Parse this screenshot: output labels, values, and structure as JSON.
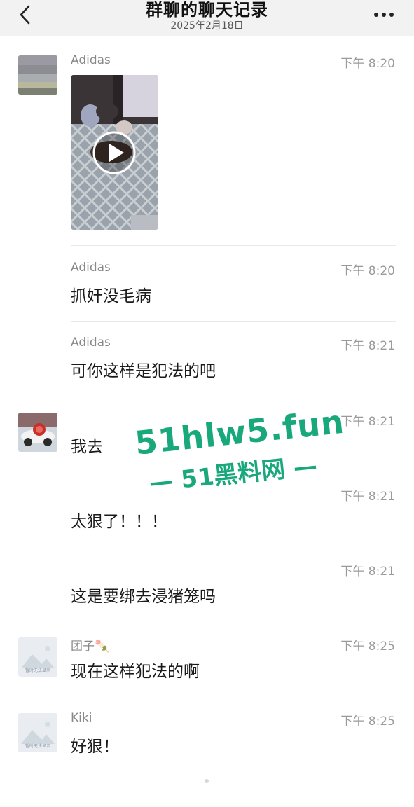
{
  "header": {
    "title": "群聊的聊天记录",
    "date": "2025年2月18日"
  },
  "messages": [
    {
      "name": "Adidas",
      "time": "下午 8:20",
      "type": "video"
    },
    {
      "name": "Adidas",
      "time": "下午 8:20",
      "text": "抓奸没毛病"
    },
    {
      "name": "Adidas",
      "time": "下午 8:21",
      "text": "可你这样是犯法的吧"
    },
    {
      "name": "",
      "time": "下午 8:21",
      "text": "我去"
    },
    {
      "name": "",
      "time": "下午 8:21",
      "text": "太狠了！！！"
    },
    {
      "name": "",
      "time": "下午 8:21",
      "text": "这是要绑去浸猪笼吗"
    },
    {
      "name": "团子🍡",
      "time": "下午 8:25",
      "text": "现在这样犯法的啊"
    },
    {
      "name": "Kiki",
      "time": "下午 8:25",
      "text": "好狠！"
    }
  ],
  "avatars": {
    "placeholder_caption": "暂时无法显示"
  },
  "watermark": {
    "line1": "51hlw5.fun",
    "line2": "— 51黑料网 —"
  },
  "icons": {
    "back": "chevron-left-icon",
    "more": "ellipsis-icon",
    "play": "play-icon"
  },
  "colors": {
    "header_bg": "#f2f2f2",
    "watermark": "#19a87c",
    "time_text": "#9a9a9a"
  }
}
